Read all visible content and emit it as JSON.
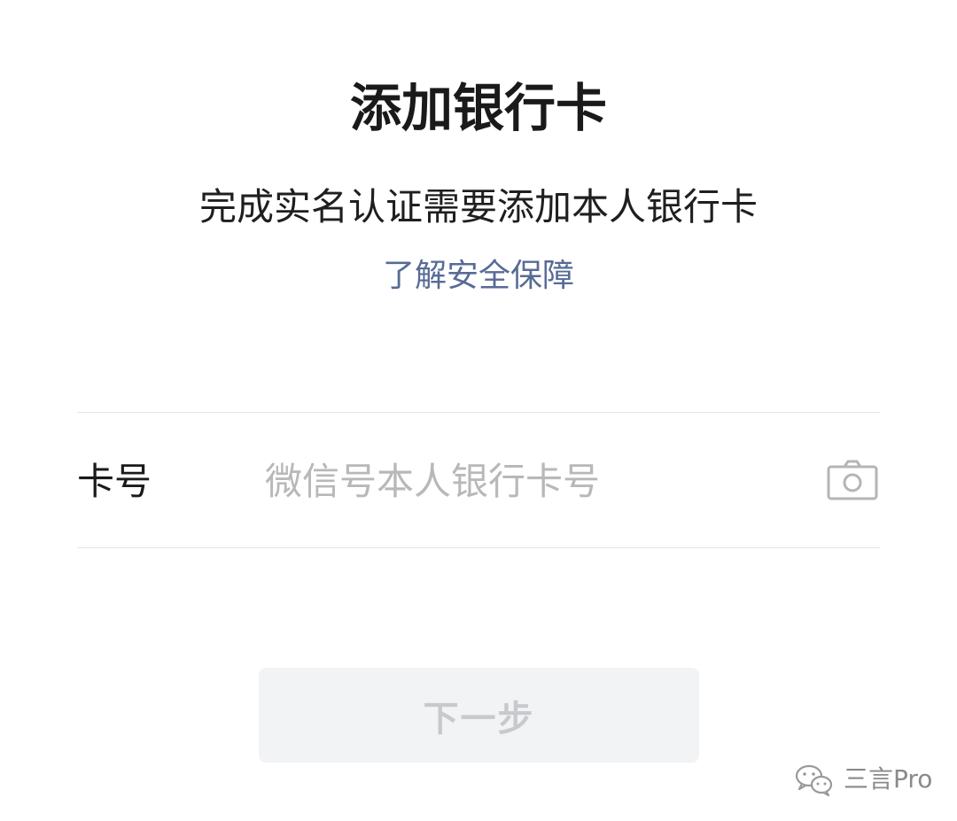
{
  "header": {
    "title": "添加银行卡",
    "subtitle": "完成实名认证需要添加本人银行卡",
    "security_link": "了解安全保障"
  },
  "form": {
    "card_label": "卡号",
    "card_placeholder": "微信号本人银行卡号",
    "card_value": "",
    "camera_icon": "camera-icon"
  },
  "actions": {
    "next_label": "下一步"
  },
  "watermark": {
    "text": "三言Pro",
    "icon": "wechat-icon"
  },
  "colors": {
    "link": "#576b95",
    "button_bg": "#f2f3f5",
    "button_text": "#c8c9cc",
    "placeholder": "#b8b8b8",
    "divider": "#e6e6e6"
  }
}
